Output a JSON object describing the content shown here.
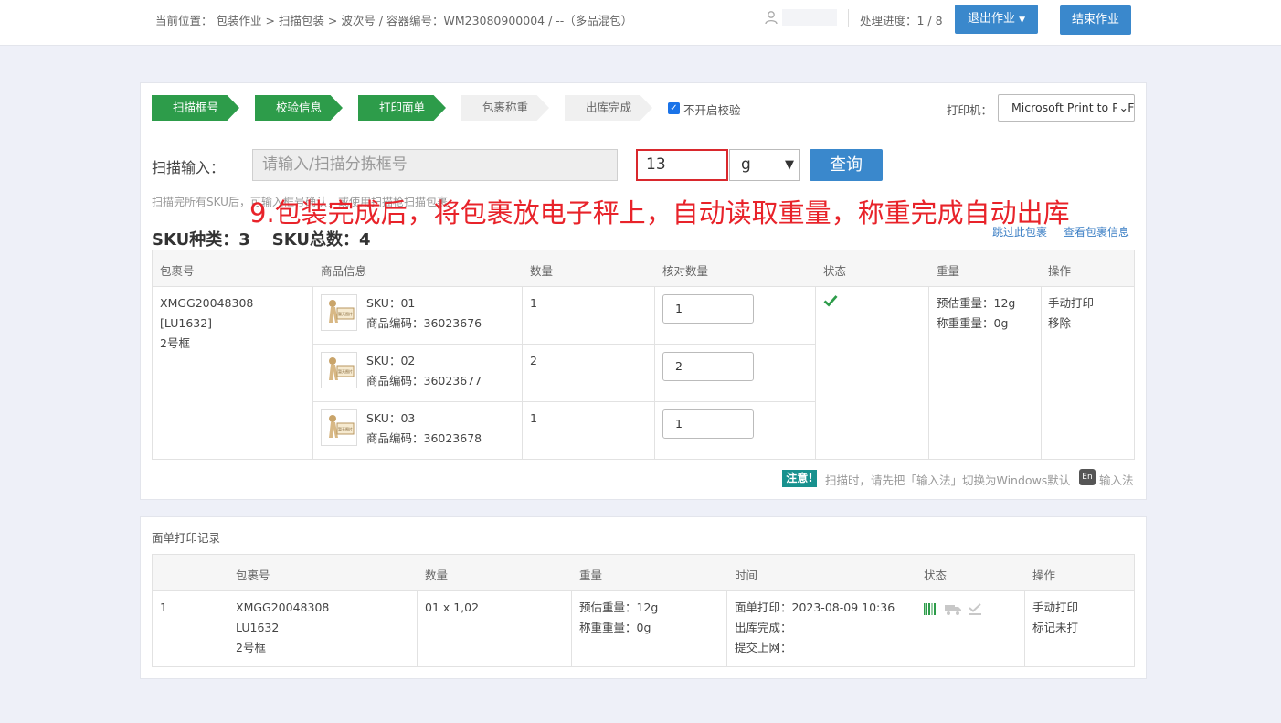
{
  "header": {
    "breadcrumb": "当前位置： 包装作业 > 扫描包装 > 波次号 / 容器编号：WM23080900004 / --（多品混包）",
    "progress_text": "处理进度：1 / 8",
    "exit_button": "退出作业",
    "finish_button": "结束作业"
  },
  "steps": [
    "扫描框号",
    "校验信息",
    "打印面单",
    "包裹称重",
    "出库完成"
  ],
  "skip_check_label": "不开启校验",
  "printer": {
    "label": "打印机：",
    "value": "Microsoft Print to PDF"
  },
  "scan": {
    "label": "扫描输入：",
    "placeholder": "请输入/扫描分拣框号",
    "weight_value": "13",
    "unit": "g",
    "query_button": "查询"
  },
  "hint": "扫描完所有SKU后，可输入框号确认，或使用扫描枪扫描包裹",
  "annotation": "9.包装完成后，将包裹放电子秤上，自动读取重量，称重完成自动出库",
  "summary": {
    "sku_types": "SKU种类：3",
    "sku_total": "SKU总数：4"
  },
  "links": {
    "skip_package": "跳过此包裹",
    "view_package": "查看包裹信息"
  },
  "sku_table": {
    "headers": [
      "包裹号",
      "商品信息",
      "数量",
      "核对数量",
      "状态",
      "重量",
      "操作"
    ],
    "package_lines": [
      "XMGG20048308",
      "[LU1632]",
      "2号框"
    ],
    "items": [
      {
        "sku": "SKU：01",
        "code": "商品编码：36023676",
        "qty": "1",
        "check_qty": "1"
      },
      {
        "sku": "SKU：02",
        "code": "商品编码：36023677",
        "qty": "2",
        "check_qty": "2"
      },
      {
        "sku": "SKU：03",
        "code": "商品编码：36023678",
        "qty": "1",
        "check_qty": "1"
      }
    ],
    "thumb_text": "暂无图片",
    "est_weight": "预估重量：12g",
    "real_weight": "称重重量：0g",
    "actions": [
      "手动打印",
      "移除"
    ]
  },
  "notice": {
    "badge": "注意!",
    "text": "扫描时，请先把「输入法」切换为Windows默认",
    "en": "En",
    "text2": "输入法"
  },
  "print_log": {
    "title": "面单打印记录",
    "headers": [
      "",
      "包裹号",
      "数量",
      "重量",
      "时间",
      "状态",
      "操作"
    ],
    "row": {
      "index": "1",
      "package_lines": [
        "XMGG20048308",
        "LU1632",
        "2号框"
      ],
      "qty": "01 x 1,02",
      "est_weight": "预估重量：12g",
      "real_weight": "称重重量：0g",
      "time_print": "面单打印：2023-08-09 10:36",
      "time_out": "出库完成：",
      "time_submit": "提交上网：",
      "actions": [
        "手动打印",
        "标记未打"
      ]
    }
  },
  "colors": {
    "primary": "#3a88cc",
    "step_done": "#2d9c4a",
    "annotation": "#e8232a",
    "notice": "#18918e"
  }
}
